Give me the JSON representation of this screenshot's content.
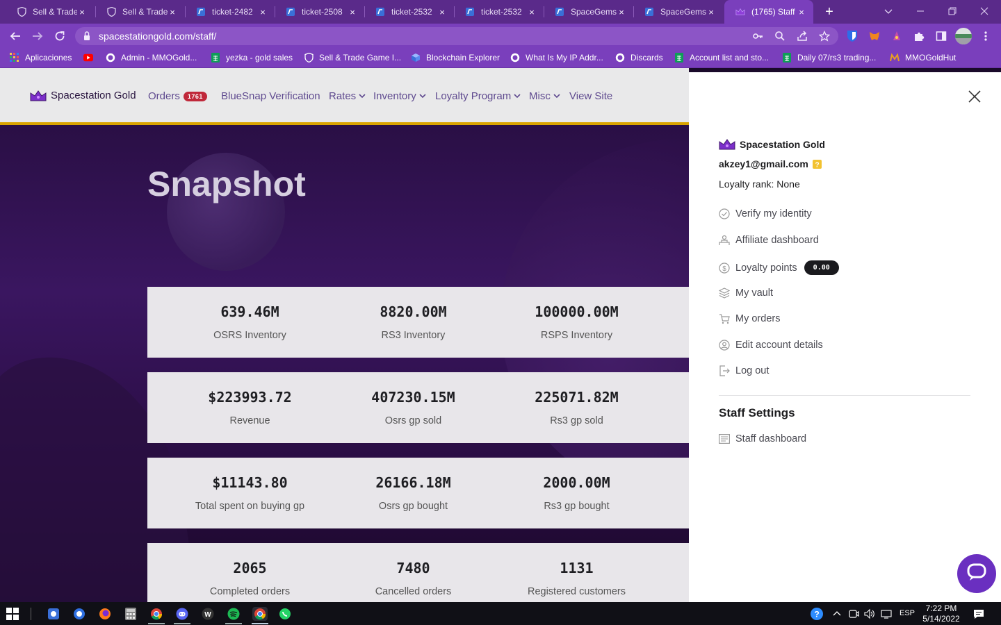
{
  "browser": {
    "tabs": [
      {
        "title": "Sell & Trade",
        "favicon": "shield-icon",
        "active": false
      },
      {
        "title": "Sell & Trade",
        "favicon": "shield-icon",
        "active": false
      },
      {
        "title": "ticket-2482",
        "favicon": "gorgias-icon",
        "active": false
      },
      {
        "title": "ticket-2508",
        "favicon": "gorgias-icon",
        "active": false
      },
      {
        "title": "ticket-2532",
        "favicon": "gorgias-icon",
        "active": false
      },
      {
        "title": "ticket-2532",
        "favicon": "gorgias-icon",
        "active": false
      },
      {
        "title": "SpaceGems",
        "favicon": "gorgias-icon",
        "active": false
      },
      {
        "title": "SpaceGems",
        "favicon": "gorgias-icon",
        "active": false
      },
      {
        "title": "(1765) Staff",
        "favicon": "crown-icon",
        "active": true
      }
    ],
    "new_tab": "+",
    "close_glyph": "×",
    "url": "spacestationgold.com/staff/",
    "bookmarks": [
      {
        "label": "Aplicaciones",
        "icon": "apps-grid-icon"
      },
      {
        "label": "",
        "icon": "youtube-icon"
      },
      {
        "label": "Admin - MMOGold...",
        "icon": "globe-icon"
      },
      {
        "label": "yezka - gold sales",
        "icon": "sheets-icon"
      },
      {
        "label": "Sell & Trade Game I...",
        "icon": "shield-icon"
      },
      {
        "label": "Blockchain Explorer",
        "icon": "cube-icon"
      },
      {
        "label": "What Is My IP Addr...",
        "icon": "globe-icon"
      },
      {
        "label": "Discards",
        "icon": "globe-icon"
      },
      {
        "label": "Account list and sto...",
        "icon": "sheets-icon"
      },
      {
        "label": "Daily 07/rs3 trading...",
        "icon": "sheets-icon"
      },
      {
        "label": "MMOGoldHut",
        "icon": "mmogoldhut-icon"
      }
    ]
  },
  "site": {
    "brand": "Spacestation Gold",
    "nav": {
      "orders": "Orders",
      "orders_badge": "1761",
      "bluesnap": "BlueSnap Verification",
      "rates": "Rates",
      "inventory": "Inventory",
      "loyalty": "Loyalty Program",
      "misc": "Misc",
      "view_site": "View Site"
    },
    "page_title": "Snapshot",
    "stats": [
      [
        {
          "value": "639.46M",
          "label": "OSRS Inventory"
        },
        {
          "value": "8820.00M",
          "label": "RS3 Inventory"
        },
        {
          "value": "100000.00M",
          "label": "RSPS Inventory"
        }
      ],
      [
        {
          "value": "$223993.72",
          "label": "Revenue"
        },
        {
          "value": "407230.15M",
          "label": "Osrs gp sold"
        },
        {
          "value": "225071.82M",
          "label": "Rs3 gp sold"
        }
      ],
      [
        {
          "value": "$11143.80",
          "label": "Total spent on buying gp"
        },
        {
          "value": "26166.18M",
          "label": "Osrs gp bought"
        },
        {
          "value": "2000.00M",
          "label": "Rs3 gp bought"
        }
      ],
      [
        {
          "value": "2065",
          "label": "Completed orders"
        },
        {
          "value": "7480",
          "label": "Cancelled orders"
        },
        {
          "value": "1131",
          "label": "Registered customers"
        }
      ]
    ]
  },
  "drawer": {
    "brand": "Spacestation Gold",
    "email": "akzey1@gmail.com",
    "loyalty_rank": "Loyalty rank: None",
    "menu": [
      {
        "label": "Verify my identity",
        "icon": "check-circle-icon"
      },
      {
        "label": "Affiliate dashboard",
        "icon": "affiliate-icon"
      },
      {
        "label": "Loyalty points",
        "icon": "dollar-circle-icon"
      },
      {
        "label": "My vault",
        "icon": "vault-icon"
      },
      {
        "label": "My orders",
        "icon": "cart-icon"
      },
      {
        "label": "Edit account details",
        "icon": "user-circle-icon"
      },
      {
        "label": "Log out",
        "icon": "logout-icon"
      }
    ],
    "loyalty_points": "0.00",
    "staff_title": "Staff Settings",
    "staff_dashboard": "Staff dashboard",
    "close_glyph": "×"
  },
  "taskbar": {
    "language": "ESP",
    "time": "7:22 PM",
    "date": "5/14/2022"
  },
  "colors": {
    "chrome_frame": "#5a2a8a",
    "chrome_toolbar": "#7a3fbc",
    "header_bg": "#e9e9ea",
    "gold_accent": "#d9a400",
    "badge_red": "#c0283a",
    "chat_purple": "#6a2fc0"
  }
}
